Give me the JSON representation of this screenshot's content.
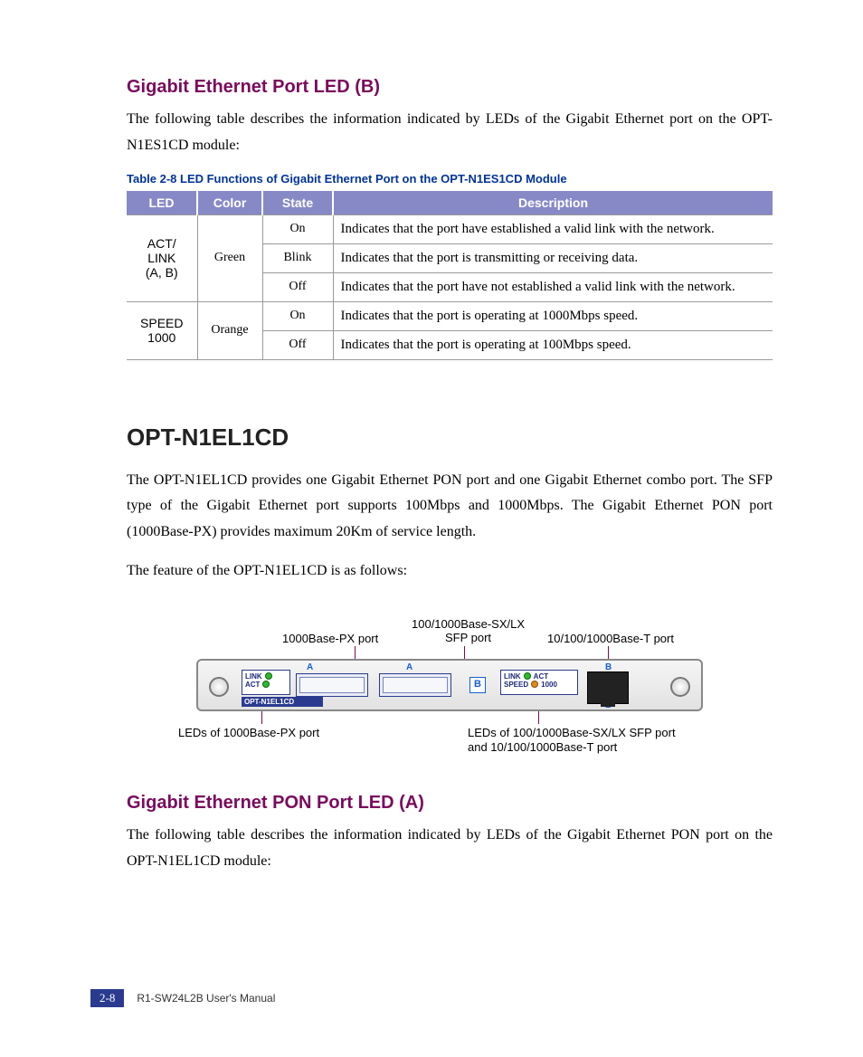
{
  "section1": {
    "heading": "Gigabit Ethernet Port LED (B)",
    "intro": "The following table describes the information indicated by LEDs of the Gigabit Ethernet port on the OPT-N1ES1CD module:",
    "table_caption": "Table 2-8    LED Functions of Gigabit Ethernet Port on the OPT-N1ES1CD Module",
    "columns": {
      "c1": "LED",
      "c2": "Color",
      "c3": "State",
      "c4": "Description"
    },
    "rows": [
      {
        "led": "ACT/\nLINK\n(A, B)",
        "led_rows": 3,
        "color": "Green",
        "color_rows": 3,
        "state": "On",
        "desc": "Indicates that the port have established a valid link with the network."
      },
      {
        "state": "Blink",
        "desc": "Indicates that the port is transmitting or receiving data."
      },
      {
        "state": "Off",
        "desc": "Indicates that the port have not established a valid link with the network."
      },
      {
        "led": "SPEED\n1000",
        "led_rows": 2,
        "color": "Orange",
        "color_rows": 2,
        "state": "On",
        "desc": "Indicates that the port is operating at 1000Mbps speed."
      },
      {
        "state": "Off",
        "desc": "Indicates that the port is operating at 100Mbps speed."
      }
    ]
  },
  "section2": {
    "heading": "OPT-N1EL1CD",
    "para1": "The OPT-N1EL1CD provides one Gigabit Ethernet PON port and one Gigabit Ethernet combo port. The SFP type of the Gigabit Ethernet port supports 100Mbps and 1000Mbps. The Gigabit Ethernet PON port (1000Base-PX) provides maximum 20Km of service length.",
    "para2": "The feature of the OPT-N1EL1CD is as follows:"
  },
  "figure": {
    "top_labels": {
      "l1": "1000Base-PX port",
      "l2": "100/1000Base-SX/LX\nSFP port",
      "l3": "10/100/1000Base-T port"
    },
    "module_tag": "OPT-N1EL1CD",
    "led_left": {
      "r1": "LINK",
      "r2": "ACT"
    },
    "led_right": {
      "r1a": "LINK",
      "r1b": "ACT",
      "r2a": "SPEED",
      "r2b": "1000"
    },
    "letterA": "A",
    "letterB": "B",
    "bottom_labels": {
      "l1": "LEDs of 1000Base-PX port",
      "l2a": "LEDs of 100/1000Base-SX/LX SFP port",
      "l2b": "and 10/100/1000Base-T port"
    }
  },
  "section3": {
    "heading": "Gigabit Ethernet PON Port LED (A)",
    "intro": "The following table describes the information indicated by LEDs of the Gigabit Ethernet PON port on the OPT-N1EL1CD module:"
  },
  "footer": {
    "page": "2-8",
    "text": "R1-SW24L2B    User's Manual"
  }
}
